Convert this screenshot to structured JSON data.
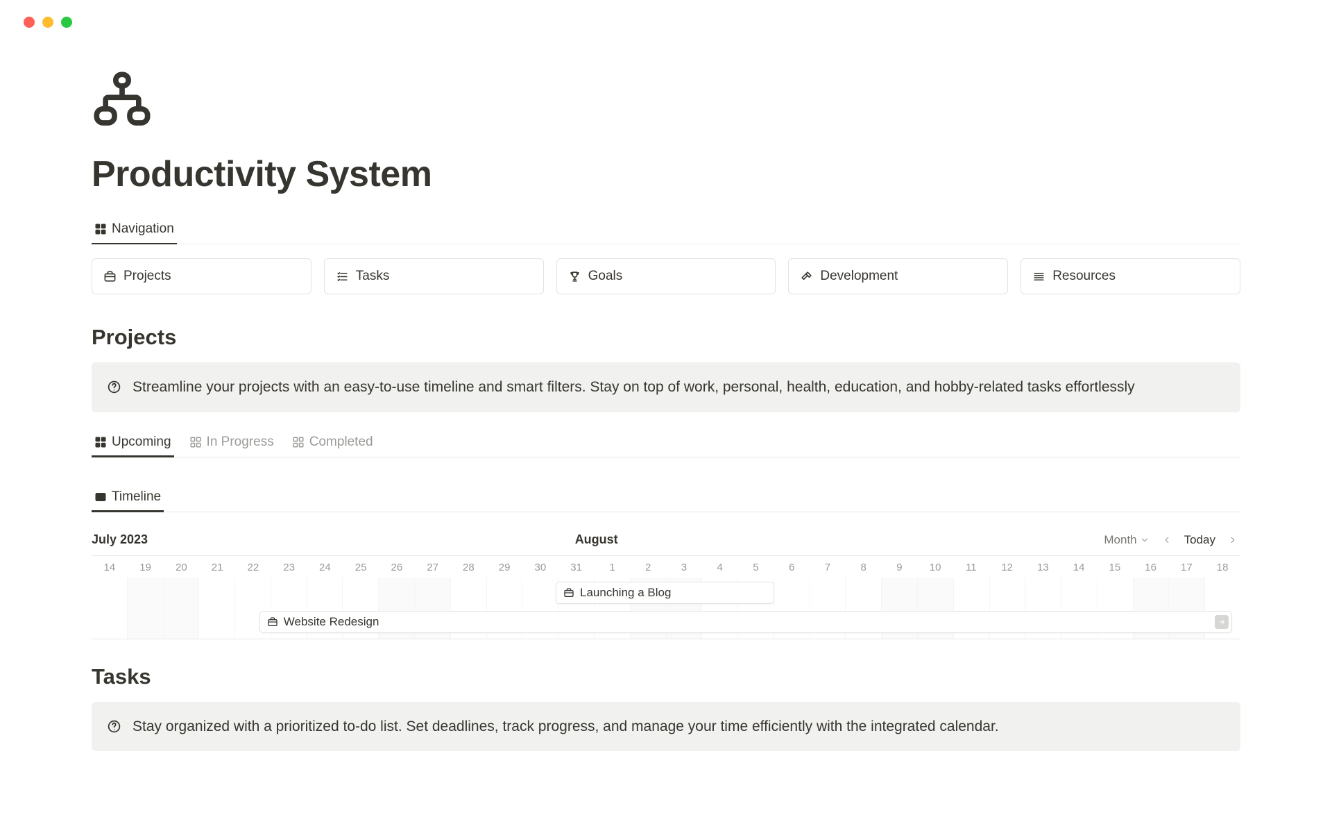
{
  "window": {
    "traffic": [
      "close",
      "minimize",
      "zoom"
    ]
  },
  "page": {
    "icon": "sitemap",
    "title": "Productivity System"
  },
  "nav_tab": {
    "label": "Navigation"
  },
  "nav_cards": [
    {
      "label": "Projects",
      "icon": "briefcase"
    },
    {
      "label": "Tasks",
      "icon": "checklist"
    },
    {
      "label": "Goals",
      "icon": "trophy"
    },
    {
      "label": "Development",
      "icon": "hammer"
    },
    {
      "label": "Resources",
      "icon": "stack"
    }
  ],
  "projects": {
    "heading": "Projects",
    "callout": "Streamline your projects with an easy-to-use timeline and smart filters. Stay on top of work, personal, health, education, and hobby-related tasks effortlessly",
    "tabs": [
      {
        "label": "Upcoming",
        "active": true
      },
      {
        "label": "In Progress",
        "active": false
      },
      {
        "label": "Completed",
        "active": false
      }
    ],
    "view_tab": {
      "label": "Timeline"
    },
    "timeline": {
      "range_primary": "July 2023",
      "range_secondary": "August",
      "scale_label": "Month",
      "today_label": "Today",
      "days": [
        "14",
        "19",
        "20",
        "21",
        "22",
        "23",
        "24",
        "25",
        "26",
        "27",
        "28",
        "29",
        "30",
        "31",
        "1",
        "2",
        "3",
        "4",
        "5",
        "6",
        "7",
        "8",
        "9",
        "10",
        "11",
        "12",
        "13",
        "14",
        "15",
        "16",
        "17",
        "18"
      ],
      "bars": [
        {
          "label": "Launching a Blog",
          "icon": "briefcase"
        },
        {
          "label": "Website Redesign",
          "icon": "briefcase",
          "overflow_right": true
        }
      ]
    }
  },
  "tasks": {
    "heading": "Tasks",
    "callout": "Stay organized with a prioritized to-do list. Set deadlines, track progress, and manage your time efficiently with the integrated calendar."
  }
}
